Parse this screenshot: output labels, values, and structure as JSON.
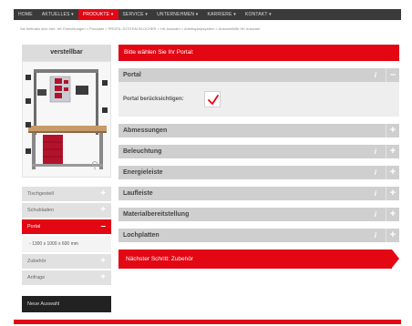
{
  "nav": {
    "items": [
      "HOME",
      "AKTUELLES ▾",
      "PRODUKTE ▾",
      "SERVICE ▾",
      "UNTERNEHMEN ▾",
      "KARRIERE ▾",
      "KONTAKT ▾"
    ],
    "active_index": 2
  },
  "breadcrumb": "Sie befinden sich hier: HK Einrichtungen > Produkte > PROFIL-SYSTEM BLOCHER > HK Auswahl > Arbeitsplatzsystem > Auswahlhilfe HK Auswahl",
  "left": {
    "title": "verstellbar",
    "items": [
      {
        "label": "Tischgestell",
        "icon": "+",
        "active": false
      },
      {
        "label": "Schubladen",
        "icon": "+",
        "active": false
      },
      {
        "label": "Portal",
        "icon": "–",
        "active": true
      }
    ],
    "sub_item": "1300 x 1000 x 600 mm",
    "items_after": [
      {
        "label": "Zubehör",
        "icon": "+"
      },
      {
        "label": "Anfrage",
        "icon": "+"
      }
    ],
    "new_button": "Neue Auswahl"
  },
  "right": {
    "header": "Bitte wählen Sie Ihr Portal:",
    "portal": {
      "title": "Portal",
      "label": "Portal berücksichtigen:",
      "checked": true
    },
    "sections": [
      "Abmessungen",
      "Beleuchtung",
      "Energieleiste",
      "Laufleiste",
      "Materialbereitstellung",
      "Lochplatten"
    ],
    "next_button": "Nächster Schritt: Zubehör"
  },
  "colors": {
    "accent": "#e30613",
    "nav_bg": "#3a3a3a",
    "section_bg": "#cfcfcf"
  }
}
